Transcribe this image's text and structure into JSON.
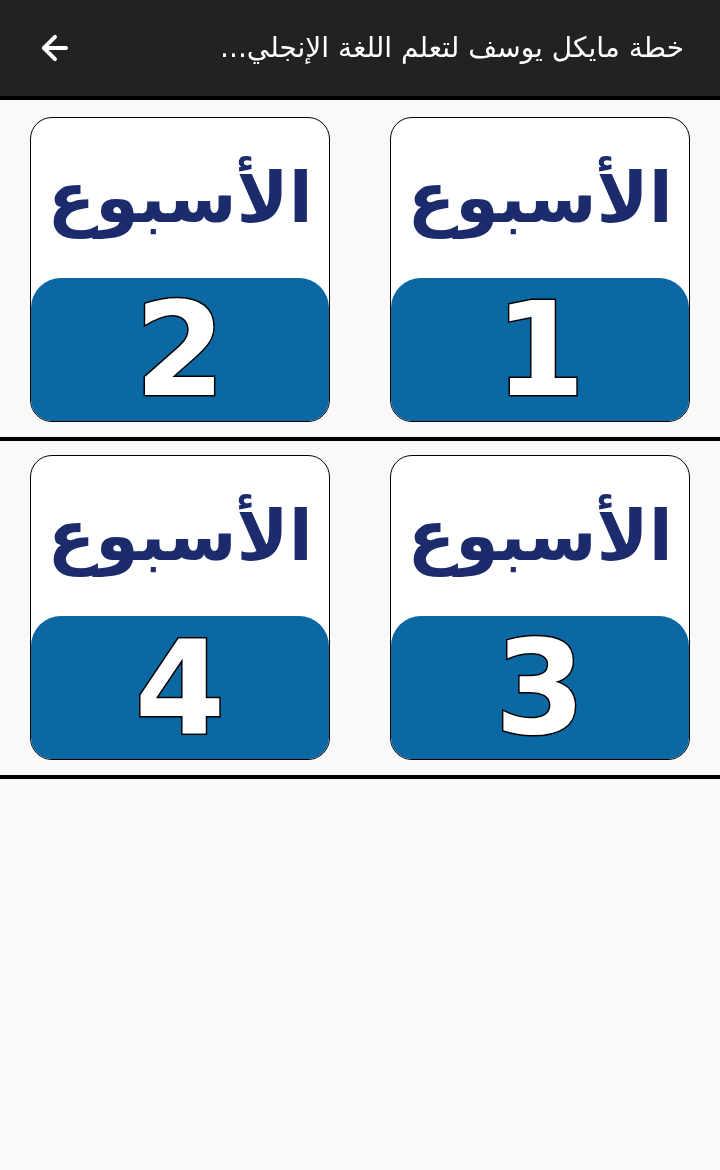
{
  "header": {
    "title": "خطة مايكل يوسف لتعلم اللغة الإنجلي..."
  },
  "rows": [
    {
      "weeks": [
        {
          "label": "الأسبوع",
          "number": "1"
        },
        {
          "label": "الأسبوع",
          "number": "2"
        }
      ]
    },
    {
      "weeks": [
        {
          "label": "الأسبوع",
          "number": "3"
        },
        {
          "label": "الأسبوع",
          "number": "4"
        }
      ]
    }
  ]
}
